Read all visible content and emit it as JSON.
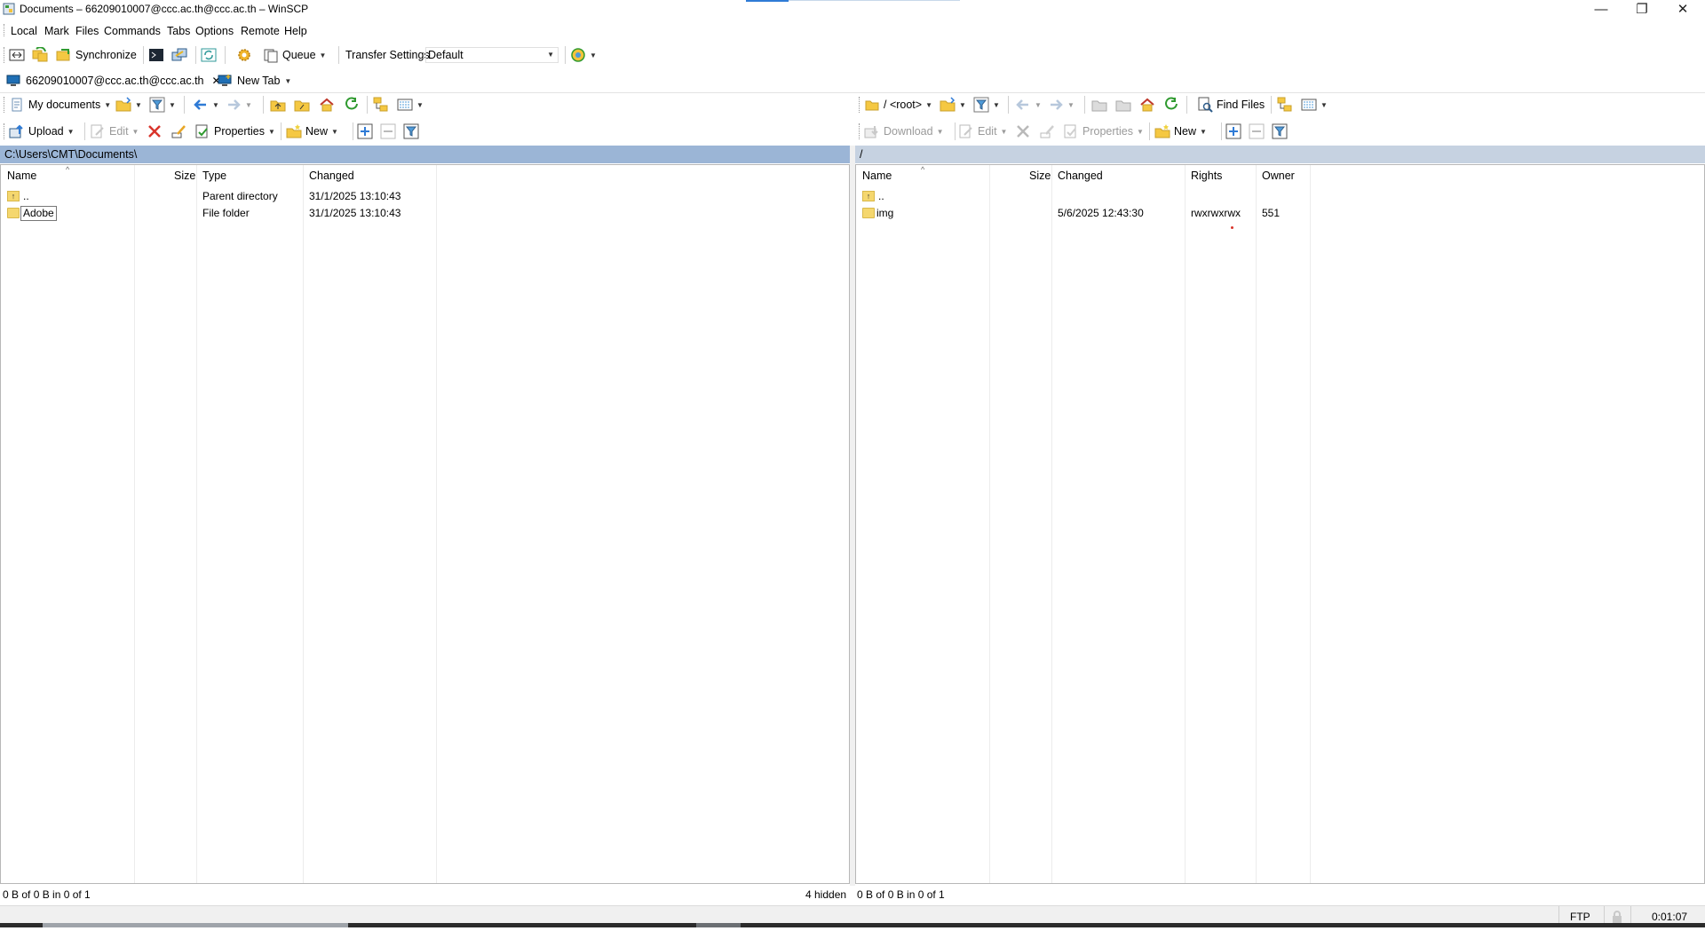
{
  "window": {
    "title": "Documents – 66209010007@ccc.ac.th@ccc.ac.th – WinSCP",
    "controls": [
      "minimize",
      "restore",
      "close"
    ]
  },
  "menu": [
    "Local",
    "Mark",
    "Files",
    "Commands",
    "Tabs",
    "Options",
    "Remote",
    "Help"
  ],
  "main_toolbar": {
    "synchronize": "Synchronize",
    "queue": "Queue",
    "transfer_settings_label": "Transfer Settings",
    "transfer_settings_value": "Default"
  },
  "tabs": [
    {
      "label": "66209010007@ccc.ac.th@ccc.ac.th",
      "active": true
    },
    {
      "label": "New Tab"
    }
  ],
  "local": {
    "location": "My documents",
    "actions": {
      "upload": "Upload",
      "edit": "Edit",
      "properties": "Properties",
      "new": "New"
    },
    "path": "C:\\Users\\CMT\\Documents\\",
    "columns": [
      "Name",
      "Size",
      "Type",
      "Changed"
    ],
    "rows": [
      {
        "name": "..",
        "size": "",
        "type": "Parent directory",
        "changed": "31/1/2025 13:10:43"
      },
      {
        "name": "Adobe",
        "size": "",
        "type": "File folder",
        "changed": "31/1/2025 13:10:43"
      }
    ],
    "status": "0 B of 0 B in 0 of 1",
    "hidden": "4 hidden"
  },
  "remote": {
    "location": "/ <root>",
    "find_files": "Find Files",
    "actions": {
      "download": "Download",
      "edit": "Edit",
      "properties": "Properties",
      "new": "New"
    },
    "path": "/",
    "columns": [
      "Name",
      "Size",
      "Changed",
      "Rights",
      "Owner"
    ],
    "rows": [
      {
        "name": "..",
        "size": "",
        "changed": "",
        "rights": "",
        "owner": ""
      },
      {
        "name": "img",
        "size": "",
        "changed": "5/6/2025 12:43:30",
        "rights": "rwxrwxrwx",
        "owner": "551"
      }
    ],
    "status": "0 B of 0 B in 0 of 1"
  },
  "bottom_status": {
    "protocol": "FTP",
    "elapsed": "0:01:07"
  },
  "colors": {
    "path_active_bg": "#9bb5d6",
    "path_inactive_bg": "#c6d2e1",
    "folder": "#f5d76e"
  }
}
